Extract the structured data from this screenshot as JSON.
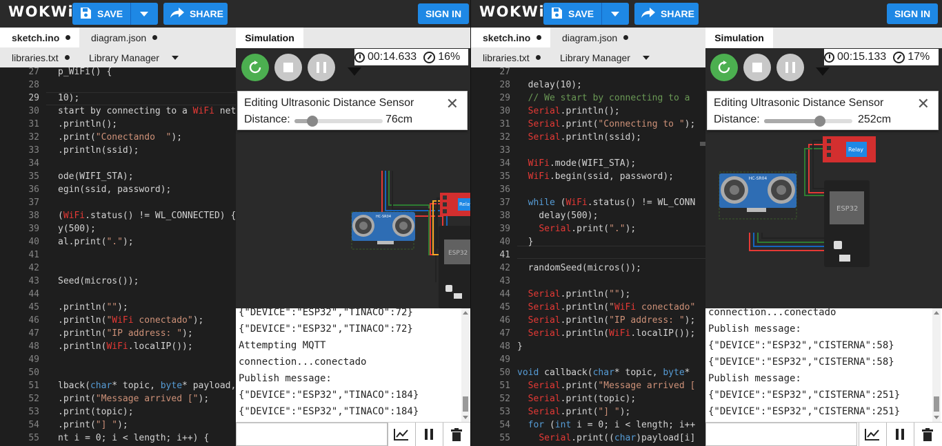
{
  "colors": {
    "accent": "#1e88e5",
    "wire_red": "#e53935",
    "wire_green": "#2e7d32",
    "wire_blue": "#1565c0",
    "wire_yellow": "#f9a825",
    "relay_board": "#d32f2f",
    "relay_box": "#1e88e5",
    "esp_board": "#212121",
    "sensor_blue": "#2e6db4"
  },
  "icons": {
    "save": "floppy-disk-icon",
    "save_menu": "chevron-down-icon",
    "share": "share-arrow-icon",
    "restart": "restart-icon",
    "stop": "stop-icon",
    "pause": "pause-icon",
    "timer": "stopwatch-icon",
    "speed": "gauge-icon",
    "close": "close-icon",
    "plot": "chart-line-icon",
    "clear": "trash-icon"
  },
  "windows": [
    {
      "logo": "WOKWi",
      "toolbar": {
        "save_label": "SAVE",
        "share_label": "SHARE",
        "signin_label": "SIGN IN"
      },
      "tabs": [
        {
          "label": "sketch.ino"
        },
        {
          "label": "diagram.json"
        },
        {
          "label": "libraries.txt"
        },
        {
          "label": "Library Manager"
        }
      ],
      "editor": {
        "line_numbers": [
          "27",
          "28",
          "29",
          "30",
          "31",
          "32",
          "33",
          "34",
          "35",
          "36",
          "37",
          "38",
          "39",
          "40",
          "41",
          "42",
          "43",
          "44",
          "45",
          "46",
          "47",
          "48",
          "49",
          "50",
          "51",
          "52",
          "53",
          "54",
          "55"
        ],
        "lines": [
          "p_WiFi() {",
          "",
          "10);",
          "start by connecting to a WiFi netw",
          ".println();",
          ".print(\"Conectando  \");",
          ".println(ssid);",
          "",
          "ode(WIFI_STA);",
          "egin(ssid, password);",
          "",
          "(WiFi.status() != WL_CONNECTED) {",
          "y(500);",
          "al.print(\".\");",
          "",
          "",
          "Seed(micros());",
          "",
          ".println(\"\");",
          ".println(\"WiFi conectado\");",
          ".println(\"IP address: \");",
          ".println(WiFi.localIP());",
          "",
          "",
          "lback(char* topic, byte* payload,",
          ".print(\"Message arrived [\");",
          ".print(topic);",
          ".print(\"] \");",
          "nt i = 0; i < length; i++) {"
        ]
      },
      "simulation": {
        "tab_label": "Simulation",
        "timer": "00:14.633",
        "speed": "16%",
        "popup": {
          "title": "Editing Ultrasonic Distance Sensor",
          "label": "Distance:",
          "value": "76cm",
          "level_fraction": 0.2
        },
        "serial": [
          "{\"DEVICE\":\"ESP32\",\"TINACO\":72}",
          "{\"DEVICE\":\"ESP32\",\"TINACO\":72}",
          "Attempting MQTT",
          "connection...conectado",
          "Publish message:",
          "{\"DEVICE\":\"ESP32\",\"TINACO\":184}",
          "{\"DEVICE\":\"ESP32\",\"TINACO\":184}"
        ]
      }
    },
    {
      "logo": "WOKWi",
      "toolbar": {
        "save_label": "SAVE",
        "share_label": "SHARE",
        "signin_label": "SIGN IN"
      },
      "tabs": [
        {
          "label": "sketch.ino"
        },
        {
          "label": "diagram.json"
        },
        {
          "label": "libraries.txt"
        },
        {
          "label": "Library Manager"
        }
      ],
      "editor": {
        "line_numbers": [
          "27",
          "28",
          "29",
          "30",
          "31",
          "32",
          "33",
          "34",
          "35",
          "36",
          "37",
          "38",
          "39",
          "40",
          "41",
          "42",
          "43",
          "44",
          "45",
          "46",
          "47",
          "48",
          "49",
          "50",
          "51",
          "52",
          "53",
          "54",
          "55"
        ],
        "lines": [
          "",
          "  delay(10);",
          "  // We start by connecting to a",
          "  Serial.println();",
          "  Serial.print(\"Connecting to \");",
          "  Serial.println(ssid);",
          "",
          "  WiFi.mode(WIFI_STA);",
          "  WiFi.begin(ssid, password);",
          "",
          "  while (WiFi.status() != WL_CONN",
          "    delay(500);",
          "    Serial.print(\".\");",
          "  }",
          "",
          "  randomSeed(micros());",
          "",
          "  Serial.println(\"\");",
          "  Serial.println(\"WiFi conectado\"",
          "  Serial.println(\"IP address: \");",
          "  Serial.println(WiFi.localIP());",
          "}",
          "",
          "void callback(char* topic, byte*",
          "  Serial.print(\"Message arrived [",
          "  Serial.print(topic);",
          "  Serial.print(\"] \");",
          "  for (int i = 0; i < length; i++",
          "    Serial.print((char)payload[i]"
        ]
      },
      "simulation": {
        "tab_label": "Simulation",
        "timer": "00:15.133",
        "speed": "17%",
        "popup": {
          "title": "Editing Ultrasonic Distance Sensor",
          "label": "Distance:",
          "value": "252cm",
          "level_fraction": 0.63
        },
        "serial": [
          "connection...conectado",
          "Publish message:",
          "{\"DEVICE\":\"ESP32\",\"CISTERNA\":58}",
          "{\"DEVICE\":\"ESP32\",\"CISTERNA\":58}",
          "Publish message:",
          "{\"DEVICE\":\"ESP32\",\"CISTERNA\":251}",
          "{\"DEVICE\":\"ESP32\",\"CISTERNA\":251}"
        ]
      }
    }
  ],
  "components": {
    "sensor_label": "HC-SR04",
    "esp_label": "ESP32",
    "relay_label": "Relay"
  }
}
